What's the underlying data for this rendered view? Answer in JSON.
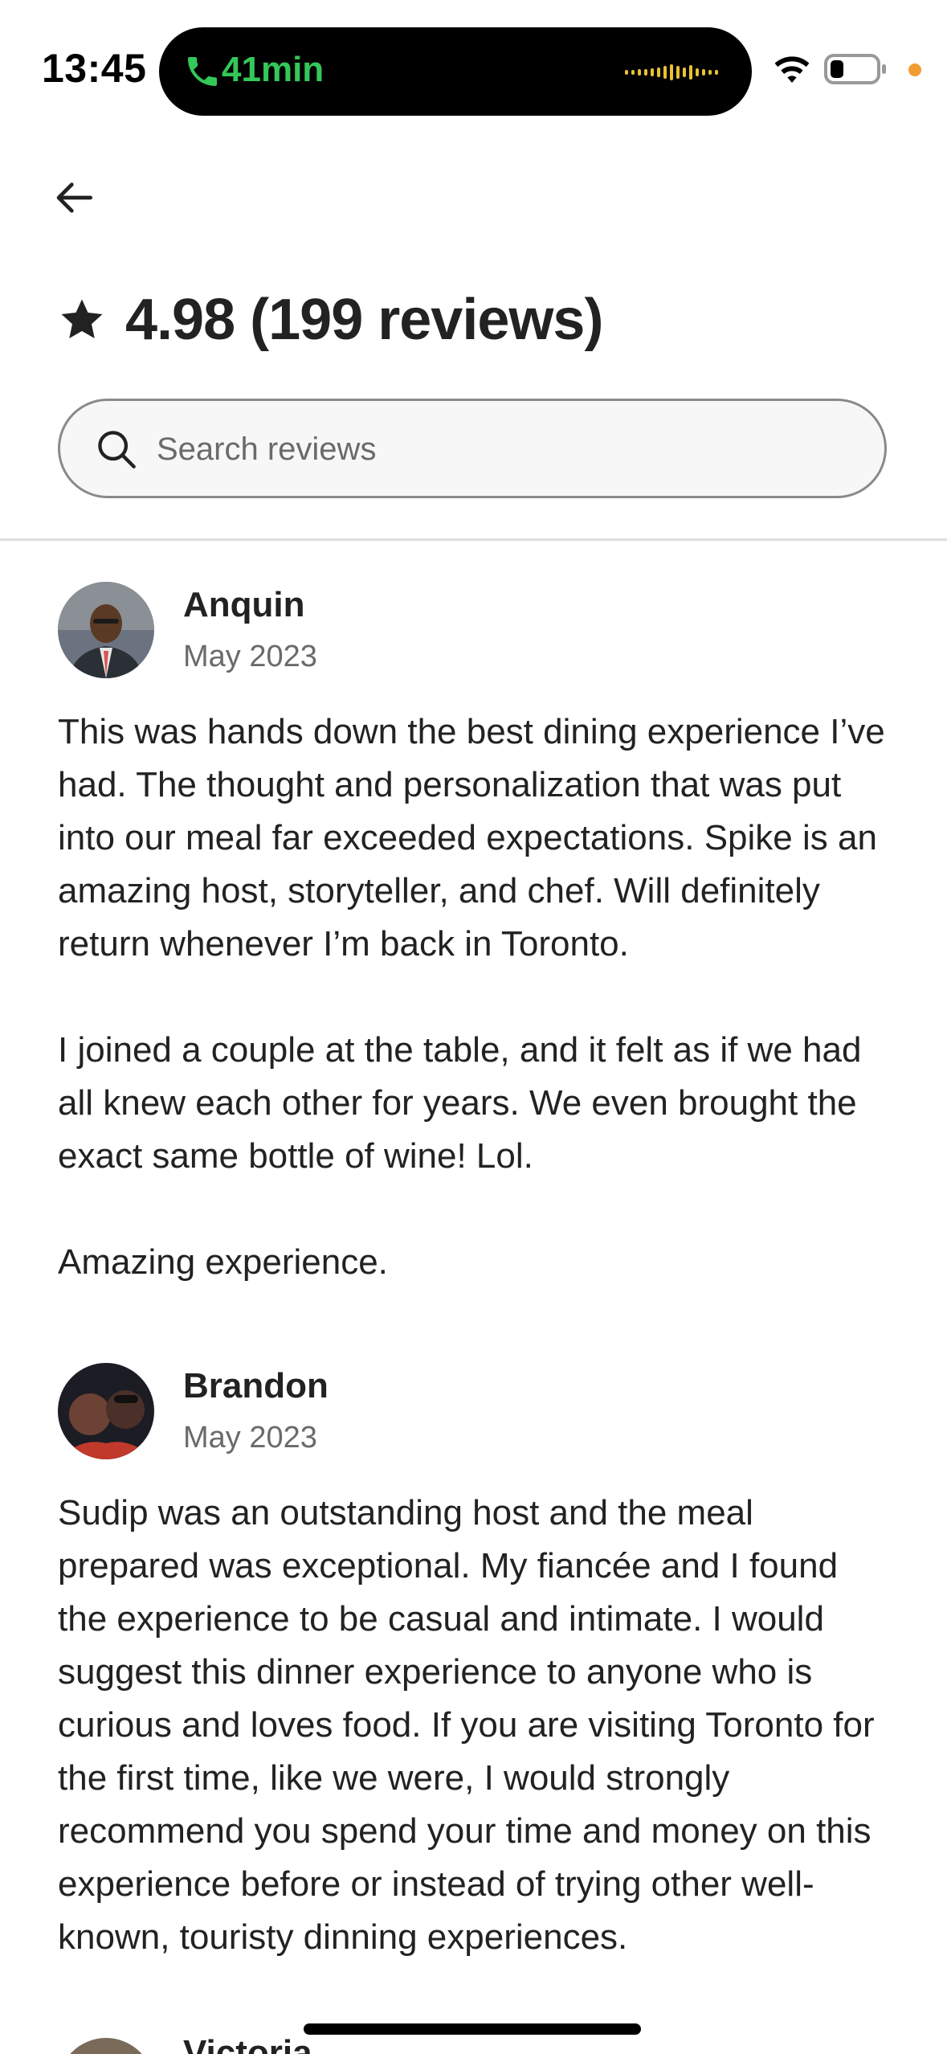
{
  "status_bar": {
    "time": "13:45",
    "call_duration": "41min",
    "icons": [
      "phone-icon",
      "waveform-icon",
      "wifi-icon",
      "battery-icon"
    ],
    "call_color": "#34c759",
    "privacy_dot_color": "#f29b30"
  },
  "header": {
    "back_icon": "arrow-left-icon",
    "star_icon": "star-icon",
    "rating_title": "4.98 (199 reviews)"
  },
  "search": {
    "placeholder": "Search reviews",
    "value": "",
    "icon": "search-icon"
  },
  "reviews": [
    {
      "name": "Anquin",
      "date": "May 2023",
      "text": "This was hands down the best dining experience I’ve had. The thought and personalization that was put into our meal far exceeded expectations. Spike is an amazing host, storyteller, and chef. Will definitely return whenever I’m back in Toronto.\n\nI joined a couple at the table, and it felt as if we had all knew each other for years. We even brought the exact same bottle of wine! Lol.\n\nAmazing experience."
    },
    {
      "name": "Brandon",
      "date": "May 2023",
      "text": "Sudip was an outstanding host and the meal prepared was exceptional. My fiancée and I found the experience to be casual and intimate. I would suggest this dinner experience to anyone who is curious and loves food. If you are visiting Toronto for the first time, like we were, I would strongly recommend you spend your time and money on this experience before or instead of trying other well-known, touristy dinning experiences."
    },
    {
      "name": "Victoria"
    }
  ]
}
